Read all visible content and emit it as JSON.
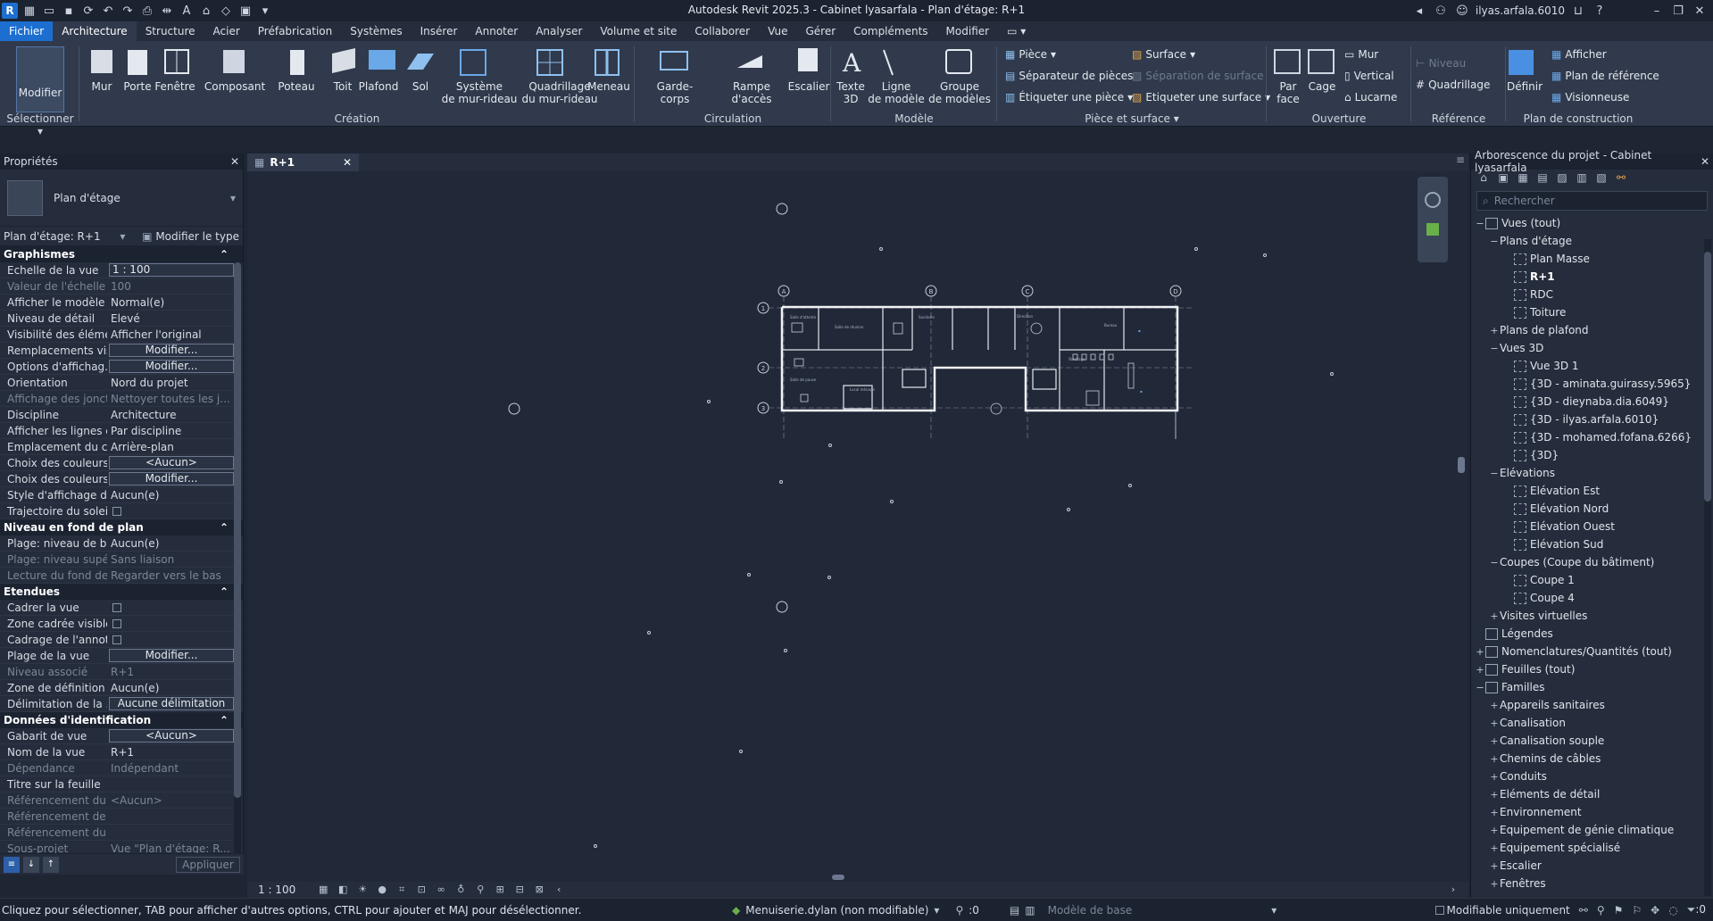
{
  "app": {
    "title": "Autodesk Revit 2025.3 - Cabinet lyasarfala - Plan d'étage: R+1",
    "user": "ilyas.arfala.6010",
    "logo": "R"
  },
  "ribbon_tabs": [
    "Fichier",
    "Architecture",
    "Structure",
    "Acier",
    "Préfabrication",
    "Systèmes",
    "Insérer",
    "Annoter",
    "Analyser",
    "Volume et site",
    "Collaborer",
    "Vue",
    "Gérer",
    "Compléments",
    "Modifier"
  ],
  "ribbon": {
    "select": {
      "modify": "Modifier",
      "label": "Sélectionner"
    },
    "creation": {
      "label": "Création",
      "items": [
        "Mur",
        "Porte",
        "Fenêtre",
        "Composant",
        "Poteau",
        "Toit",
        "Plafond",
        "Sol",
        "Système\nde mur-rideau",
        "Quadrillage\ndu mur-rideau",
        "Meneau"
      ]
    },
    "circulation": {
      "label": "Circulation",
      "items": [
        "Garde-corps",
        "Rampe d'accès",
        "Escalier"
      ]
    },
    "modele": {
      "label": "Modèle",
      "items": [
        "Texte\n3D",
        "Ligne\nde modèle",
        "Groupe\nde modèles"
      ]
    },
    "piece": {
      "label": "Pièce et surface",
      "items": [
        "Pièce",
        "Séparateur  de pièces",
        "Étiqueter une pièce",
        "Surface",
        "Séparation  de surface",
        "Etiqueter  une surface"
      ]
    },
    "ouverture": {
      "label": "Ouverture",
      "items": [
        "Par\nface",
        "Cage",
        "Mur",
        "Vertical",
        "Lucarne"
      ]
    },
    "reference": {
      "label": "Référence",
      "items": [
        "Niveau",
        "Quadrillage"
      ]
    },
    "plan": {
      "label": "Plan de construction",
      "items": [
        "Définir",
        "Afficher",
        "Plan de référence",
        "Visionneuse"
      ]
    }
  },
  "properties": {
    "title": "Propriétés",
    "type_name": "Plan d'étage",
    "instance": "Plan d'étage: R+1",
    "edit_type": "Modifier le type",
    "groups": [
      {
        "name": "Graphismes",
        "rows": [
          {
            "k": "Echelle de la vue",
            "v": "1 : 100",
            "kind": "input"
          },
          {
            "k": "Valeur de l'échelle   1:",
            "v": "100",
            "kind": "dim"
          },
          {
            "k": "Afficher le modèle",
            "v": "Normal(e)"
          },
          {
            "k": "Niveau de détail",
            "v": "Elevé"
          },
          {
            "k": "Visibilité des éléme...",
            "v": "Afficher l'original"
          },
          {
            "k": "Remplacements vis...",
            "v": "Modifier...",
            "kind": "btn"
          },
          {
            "k": "Options d'affichag...",
            "v": "Modifier...",
            "kind": "btn"
          },
          {
            "k": "Orientation",
            "v": "Nord du projet"
          },
          {
            "k": "Affichage des jonct...",
            "v": "Nettoyer toutes les j...",
            "kind": "dim"
          },
          {
            "k": "Discipline",
            "v": "Architecture"
          },
          {
            "k": "Afficher les lignes c...",
            "v": "Par discipline"
          },
          {
            "k": "Emplacement du c...",
            "v": "Arrière-plan"
          },
          {
            "k": "Choix des couleurs",
            "v": "<Aucun>",
            "kind": "btn"
          },
          {
            "k": "Choix des couleurs...",
            "v": "Modifier...",
            "kind": "btn"
          },
          {
            "k": "Style d'affichage d...",
            "v": "Aucun(e)"
          },
          {
            "k": "Trajectoire du soleil",
            "v": "",
            "kind": "chk"
          }
        ]
      },
      {
        "name": "Niveau en fond de plan",
        "rows": [
          {
            "k": "Plage: niveau de ba...",
            "v": "Aucun(e)"
          },
          {
            "k": "Plage: niveau supér...",
            "v": "Sans liaison",
            "kind": "dim"
          },
          {
            "k": "Lecture du fond de...",
            "v": "Regarder vers le bas",
            "kind": "dim"
          }
        ]
      },
      {
        "name": "Etendues",
        "rows": [
          {
            "k": "Cadrer la vue",
            "v": "",
            "kind": "chk"
          },
          {
            "k": "Zone cadrée visible",
            "v": "",
            "kind": "chk"
          },
          {
            "k": "Cadrage de l'annot...",
            "v": "",
            "kind": "chk"
          },
          {
            "k": "Plage de la vue",
            "v": "Modifier...",
            "kind": "btn"
          },
          {
            "k": "Niveau associé",
            "v": "R+1",
            "kind": "dim"
          },
          {
            "k": "Zone de définition",
            "v": "Aucun(e)"
          },
          {
            "k": "Délimitation de la ...",
            "v": "Aucune délimitation",
            "kind": "btn"
          }
        ]
      },
      {
        "name": "Données d'identification",
        "rows": [
          {
            "k": "Gabarit de vue",
            "v": "<Aucun>",
            "kind": "btn"
          },
          {
            "k": "Nom de la vue",
            "v": "R+1"
          },
          {
            "k": "Dépendance",
            "v": "Indépendant",
            "kind": "dim"
          },
          {
            "k": "Titre sur la feuille",
            "v": ""
          },
          {
            "k": "Référencement du ...",
            "v": "<Aucun>",
            "kind": "dim"
          },
          {
            "k": "Référencement de l...",
            "v": "",
            "kind": "dim"
          },
          {
            "k": "Référencement du ...",
            "v": "",
            "kind": "dim"
          },
          {
            "k": "Sous-projet",
            "v": "Vue \"Plan d'étage: R...",
            "kind": "dim"
          }
        ]
      }
    ],
    "apply": "Appliquer"
  },
  "view": {
    "tab": "R+1",
    "scale": "1 : 100",
    "grid_labels": [
      "A",
      "B",
      "C",
      "D",
      "1",
      "2",
      "3"
    ],
    "room_labels": [
      "Salle d'attente",
      "Salle de réunion",
      "Sanitaire",
      "Local ménage",
      "Bureau",
      "Salle de pause",
      "Stockage",
      "Direction"
    ]
  },
  "browser": {
    "title": "Arborescence du projet - Cabinet lyasarfala",
    "search_placeholder": "Rechercher",
    "tree": [
      {
        "label": "Vues (tout)",
        "lvl": 0,
        "tg": "−",
        "icon": "views"
      },
      {
        "label": "Plans d'étage",
        "lvl": 1,
        "tg": "−"
      },
      {
        "label": "Plan Masse",
        "lvl": 2,
        "icon": "view"
      },
      {
        "label": "R+1",
        "lvl": 2,
        "icon": "view",
        "bold": true
      },
      {
        "label": "RDC",
        "lvl": 2,
        "icon": "view"
      },
      {
        "label": "Toiture",
        "lvl": 2,
        "icon": "view"
      },
      {
        "label": "Plans de plafond",
        "lvl": 1,
        "tg": "+"
      },
      {
        "label": "Vues 3D",
        "lvl": 1,
        "tg": "−"
      },
      {
        "label": "Vue 3D 1",
        "lvl": 2,
        "icon": "view"
      },
      {
        "label": "{3D - aminata.guirassy.5965}",
        "lvl": 2,
        "icon": "view"
      },
      {
        "label": "{3D - dieynaba.dia.6049}",
        "lvl": 2,
        "icon": "view"
      },
      {
        "label": "{3D - ilyas.arfala.6010}",
        "lvl": 2,
        "icon": "view"
      },
      {
        "label": "{3D - mohamed.fofana.6266}",
        "lvl": 2,
        "icon": "view"
      },
      {
        "label": "{3D}",
        "lvl": 2,
        "icon": "view"
      },
      {
        "label": "Elévations",
        "lvl": 1,
        "tg": "−"
      },
      {
        "label": "Elévation Est",
        "lvl": 2,
        "icon": "view"
      },
      {
        "label": "Elévation Nord",
        "lvl": 2,
        "icon": "view"
      },
      {
        "label": "Elévation Ouest",
        "lvl": 2,
        "icon": "view"
      },
      {
        "label": "Elévation Sud",
        "lvl": 2,
        "icon": "view"
      },
      {
        "label": "Coupes (Coupe du bâtiment)",
        "lvl": 1,
        "tg": "−"
      },
      {
        "label": "Coupe 1",
        "lvl": 2,
        "icon": "view"
      },
      {
        "label": "Coupe 4",
        "lvl": 2,
        "icon": "view"
      },
      {
        "label": "Visites virtuelles",
        "lvl": 1,
        "tg": "+"
      },
      {
        "label": "Légendes",
        "lvl": 0,
        "icon": "legend"
      },
      {
        "label": "Nomenclatures/Quantités (tout)",
        "lvl": 0,
        "tg": "+",
        "icon": "table"
      },
      {
        "label": "Feuilles (tout)",
        "lvl": 0,
        "tg": "+",
        "icon": "sheet"
      },
      {
        "label": "Familles",
        "lvl": 0,
        "tg": "−",
        "icon": "family"
      },
      {
        "label": "Appareils sanitaires",
        "lvl": 1,
        "tg": "+"
      },
      {
        "label": "Canalisation",
        "lvl": 1,
        "tg": "+"
      },
      {
        "label": "Canalisation souple",
        "lvl": 1,
        "tg": "+"
      },
      {
        "label": "Chemins de câbles",
        "lvl": 1,
        "tg": "+"
      },
      {
        "label": "Conduits",
        "lvl": 1,
        "tg": "+"
      },
      {
        "label": "Eléments de détail",
        "lvl": 1,
        "tg": "+"
      },
      {
        "label": "Environnement",
        "lvl": 1,
        "tg": "+"
      },
      {
        "label": "Equipement de génie climatique",
        "lvl": 1,
        "tg": "+"
      },
      {
        "label": "Equipement spécialisé",
        "lvl": 1,
        "tg": "+"
      },
      {
        "label": "Escalier",
        "lvl": 1,
        "tg": "+"
      },
      {
        "label": "Fenêtres",
        "lvl": 1,
        "tg": "+"
      }
    ]
  },
  "status": {
    "message": "Cliquez pour sélectionner, TAB pour afficher d'autres options,  CTRL pour ajouter et MAJ pour désélectionner.",
    "workset": "Menuiserie.dylan (non modifiable)",
    "count": ":0",
    "design_option": "Modèle de base",
    "editable_only": "Modifiable uniquement",
    "filter_count": ":0"
  }
}
